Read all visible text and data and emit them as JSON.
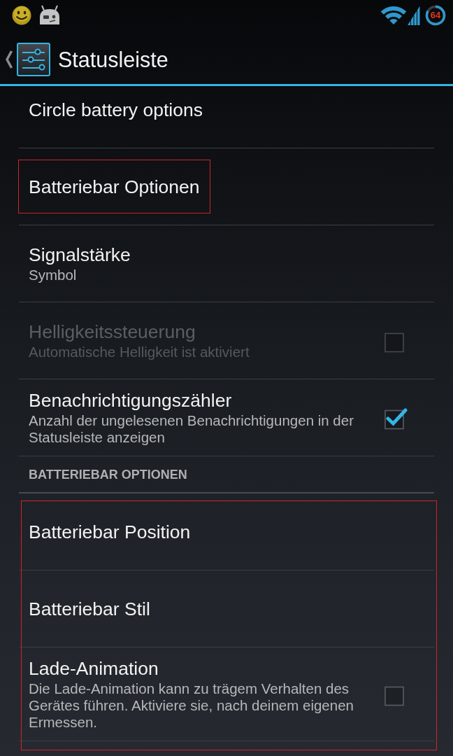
{
  "status_bar": {
    "battery_percent": "64"
  },
  "action_bar": {
    "title": "Statusleiste"
  },
  "sections": [
    {
      "highlighted": false,
      "items": [
        {
          "kind": "link",
          "title": "Circle battery options",
          "disabled": false,
          "highlighted": false
        },
        {
          "kind": "link",
          "title": "Batteriebar Optionen",
          "disabled": false,
          "highlighted": true
        },
        {
          "kind": "link",
          "title": "Signalstärke",
          "summary": "Symbol",
          "disabled": false,
          "highlighted": false
        },
        {
          "kind": "checkbox",
          "title": "Helligkeitssteuerung",
          "summary": "Automatische Helligkeit ist aktiviert",
          "checked": false,
          "disabled": true,
          "highlighted": false
        },
        {
          "kind": "checkbox",
          "title": "Benachrichtigungszähler",
          "summary": "Anzahl der ungelesenen Benachrichtigungen in der Statusleiste anzeigen",
          "checked": true,
          "disabled": false,
          "highlighted": false
        }
      ]
    },
    {
      "header": "BATTERIEBAR OPTIONEN",
      "highlighted": true,
      "items": [
        {
          "kind": "link",
          "title": "Batteriebar Position",
          "disabled": false,
          "highlighted": false
        },
        {
          "kind": "link",
          "title": "Batteriebar Stil",
          "disabled": false,
          "highlighted": false
        },
        {
          "kind": "checkbox",
          "title": "Lade-Animation",
          "summary": "Die Lade-Animation kann zu trägem Verhalten des Gerätes führen. Aktiviere sie, nach deinem eigenen Ermessen.",
          "checked": false,
          "disabled": false,
          "highlighted": false
        }
      ]
    }
  ]
}
